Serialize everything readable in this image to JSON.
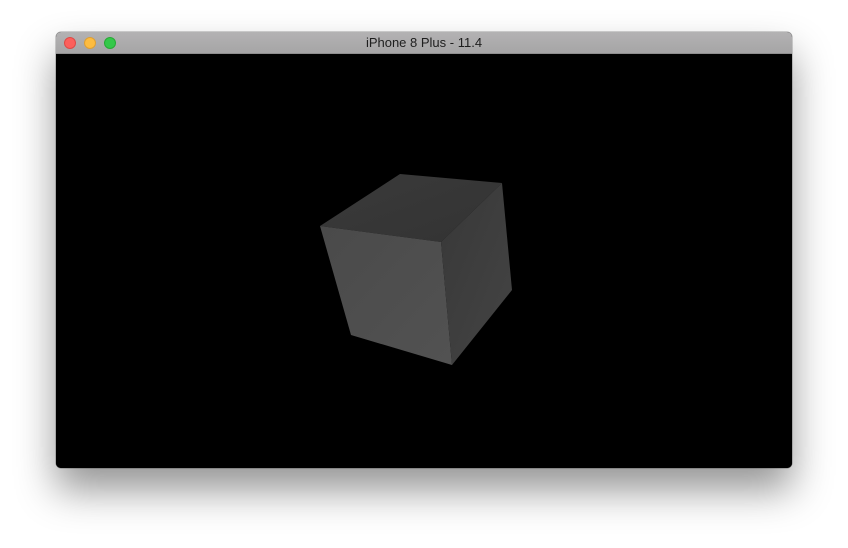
{
  "window": {
    "title": "iPhone 8 Plus - 11.4",
    "buttons": {
      "close": "close-button",
      "minimize": "minimize-button",
      "zoom": "zoom-button"
    }
  },
  "scene": {
    "background_color": "#000000",
    "object": "cube",
    "face_colors": {
      "top": "#363636",
      "front": "#4b4b4b",
      "right": "#3e3e3e"
    }
  }
}
